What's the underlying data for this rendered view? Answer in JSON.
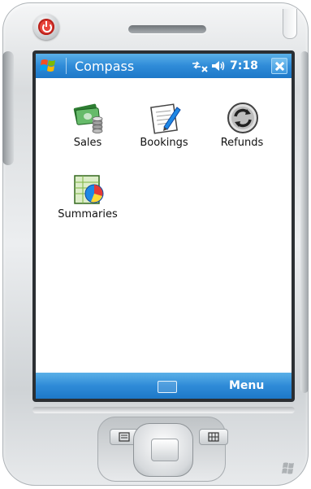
{
  "titlebar": {
    "title": "Compass",
    "time": "7:18",
    "icons": [
      "windows-start-icon",
      "connectivity-icon",
      "volume-icon",
      "close-icon"
    ]
  },
  "apps": [
    {
      "label": "Sales",
      "icon": "sales-money-icon"
    },
    {
      "label": "Bookings",
      "icon": "bookings-notepad-icon"
    },
    {
      "label": "Refunds",
      "icon": "refunds-recycle-icon"
    },
    {
      "label": "Summaries",
      "icon": "summaries-chart-icon"
    }
  ],
  "bottombar": {
    "menu_label": "Menu",
    "keyboard_icon": "keyboard-icon"
  },
  "colors": {
    "titlebar": "#2f8bd8",
    "accent": "#1d78c8",
    "power": "#e8433b"
  }
}
